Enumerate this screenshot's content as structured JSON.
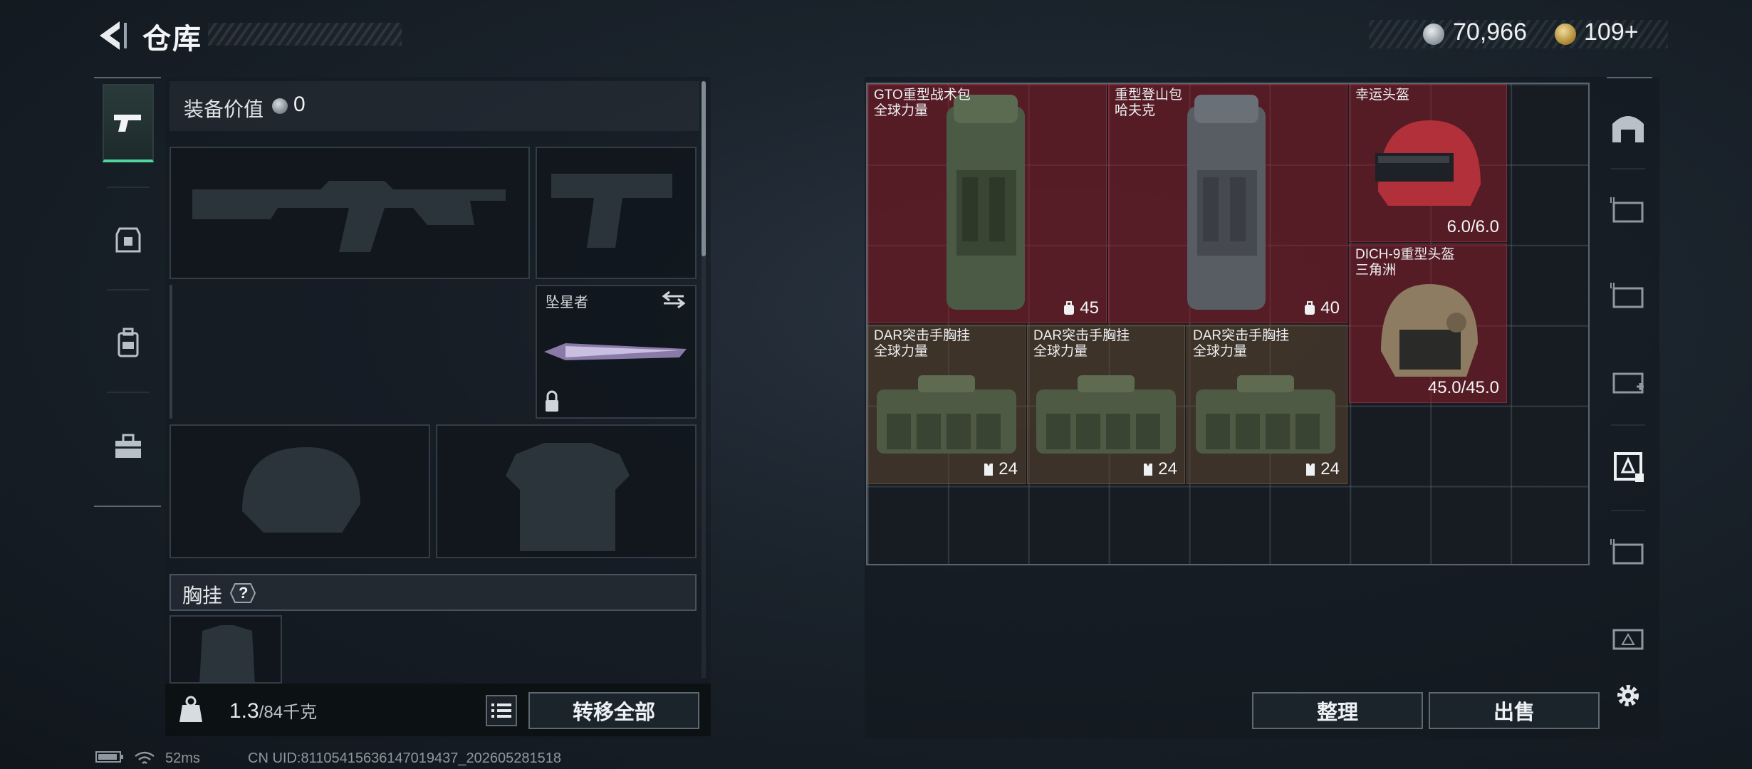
{
  "header": {
    "title": "仓库"
  },
  "currency": {
    "silver": "70,966",
    "gold": "109+"
  },
  "equipment": {
    "value_label": "装备价值",
    "value": "0",
    "melee_slot_name": "坠星者",
    "chest_rig_label": "胸挂",
    "help_badge": "?"
  },
  "weight": {
    "current": "1.3",
    "capacity": "/84千克"
  },
  "buttons": {
    "transfer_all": "转移全部",
    "sort": "整理",
    "sell": "出售"
  },
  "stash_items": [
    {
      "line1": "GTO重型战术包",
      "line2": "全球力量",
      "stat": "45",
      "stat_icon": "backpack-icon"
    },
    {
      "line1": "重型登山包",
      "line2": "哈夫克",
      "stat": "40",
      "stat_icon": "backpack-icon"
    },
    {
      "line1": "幸运头盔",
      "line2": "",
      "stat": "6.0/6.0",
      "stat_icon": ""
    },
    {
      "line1": "DICH-9重型头盔",
      "line2": "三角洲",
      "stat": "45.0/45.0",
      "stat_icon": ""
    },
    {
      "line1": "DAR突击手胸挂",
      "line2": "全球力量",
      "stat": "24",
      "stat_icon": "vest-icon"
    },
    {
      "line1": "DAR突击手胸挂",
      "line2": "全球力量",
      "stat": "24",
      "stat_icon": "vest-icon"
    },
    {
      "line1": "DAR突击手胸挂",
      "line2": "全球力量",
      "stat": "24",
      "stat_icon": "vest-icon"
    }
  ],
  "status_bar": {
    "ping": "52ms",
    "uid": "CN UID:8110541563614701943​7_202605281518"
  },
  "colors": {
    "accent_green": "#4fd6a0",
    "item_red": "#8c1e2a",
    "item_brown": "#5f4630"
  }
}
